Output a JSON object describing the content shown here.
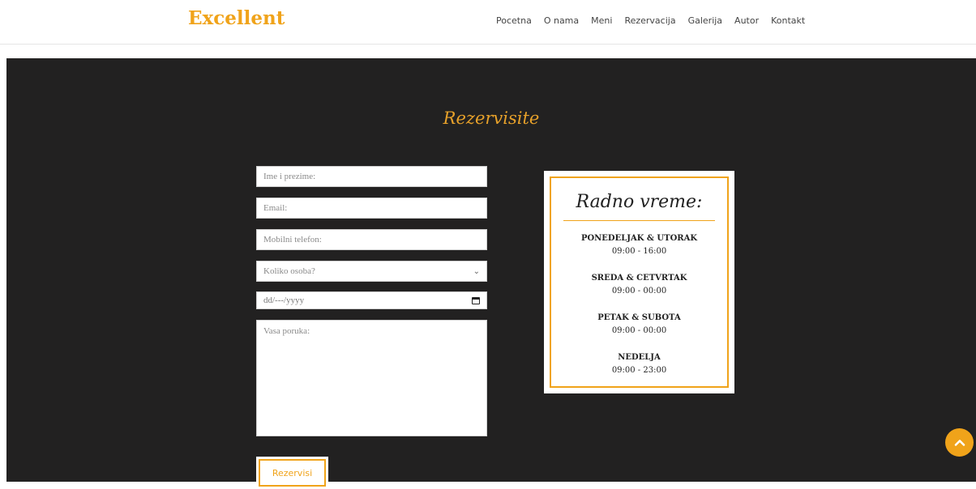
{
  "header": {
    "logo": "Excellent",
    "nav": [
      "Pocetna",
      "O nama",
      "Meni",
      "Rezervacija",
      "Galerija",
      "Autor",
      "Kontakt"
    ]
  },
  "reservation": {
    "title": "Rezervisite",
    "name_placeholder": "Ime i prezime:",
    "email_placeholder": "Email:",
    "phone_placeholder": "Mobilni telefon:",
    "people_select_value": "Koliko osoba?",
    "date_placeholder": "dd/---/yyyy",
    "message_placeholder": "Vasa poruka:",
    "submit_label": "Rezervisi"
  },
  "hours": {
    "title": "Radno vreme:",
    "items": [
      {
        "days": "PONEDELJAK & UTORAK",
        "time": "09:00 - 16:00"
      },
      {
        "days": "SREDA & CETVRTAK",
        "time": "09:00 - 00:00"
      },
      {
        "days": "PETAK & SUBOTA",
        "time": "09:00 - 00:00"
      },
      {
        "days": "NEDELJA",
        "time": "09:00 - 23:00"
      }
    ]
  },
  "icons": {
    "scroll_top": "chevron-up-icon",
    "calendar": "calendar-icon",
    "select_arrow": "chevron-down-icon"
  },
  "colors": {
    "accent": "#f0a31a",
    "dark_background": "#222121"
  }
}
